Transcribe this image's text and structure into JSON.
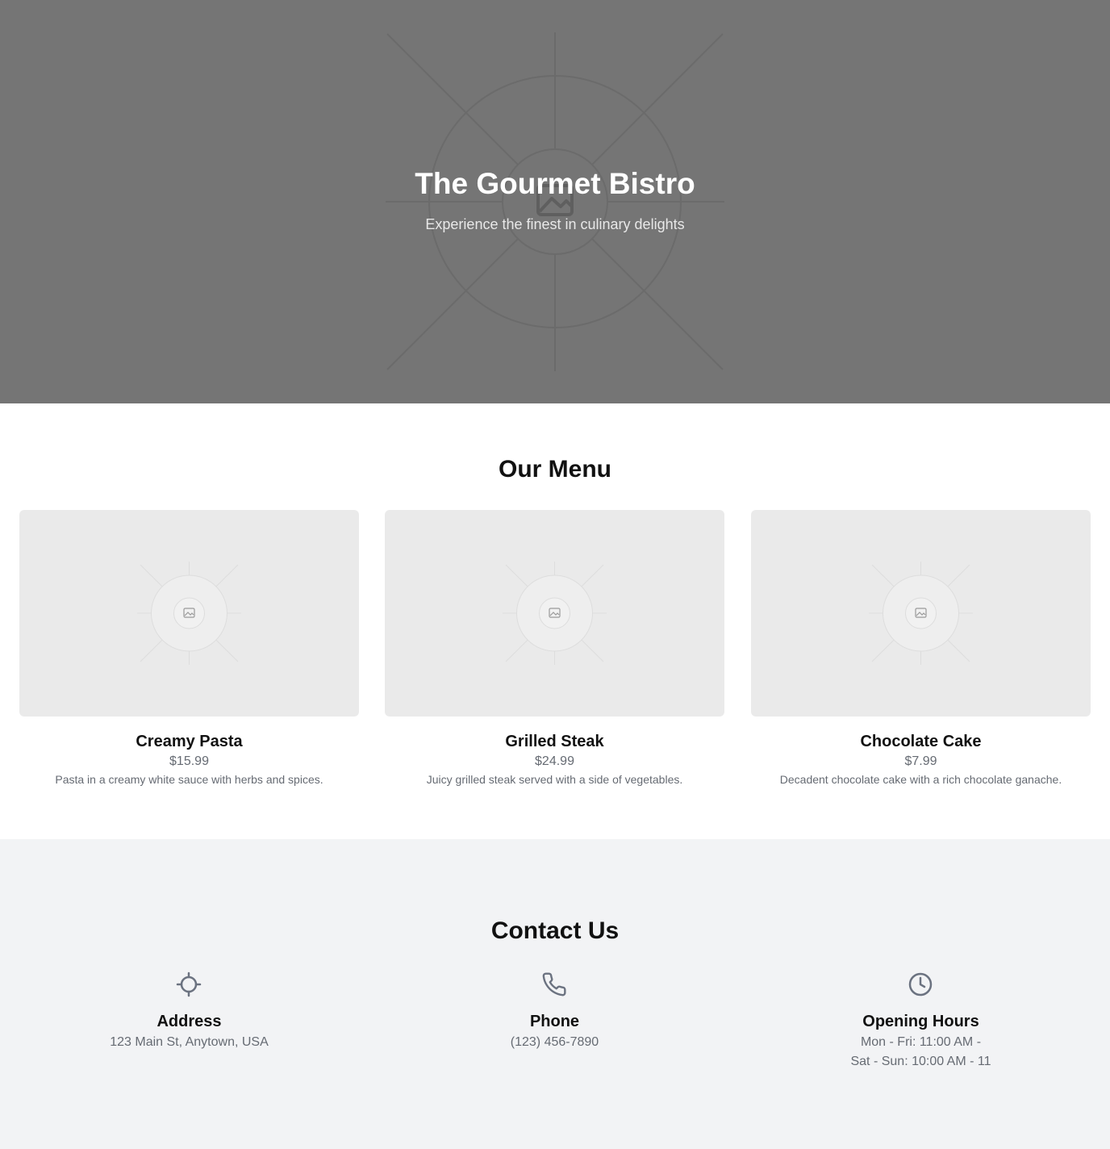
{
  "hero": {
    "title": "The Gourmet Bistro",
    "subtitle": "Experience the finest in culinary delights",
    "image_icon": "image-placeholder-icon",
    "background_color": "#757575"
  },
  "menu": {
    "heading": "Our Menu",
    "items": [
      {
        "name": "Creamy Pasta",
        "price": "$15.99",
        "description": "Pasta in a creamy white sauce with herbs and spices.",
        "image_icon": "image-placeholder-icon"
      },
      {
        "name": "Grilled Steak",
        "price": "$24.99",
        "description": "Juicy grilled steak served with a side of vegetables.",
        "image_icon": "image-placeholder-icon"
      },
      {
        "name": "Chocolate Cake",
        "price": "$7.99",
        "description": "Decadent chocolate cake with a rich chocolate ganache.",
        "image_icon": "image-placeholder-icon"
      }
    ]
  },
  "contact": {
    "heading": "Contact Us",
    "background_color": "#f2f3f5",
    "address": {
      "label": "Address",
      "value": "123 Main St, Anytown, USA",
      "icon": "location-crosshair-icon"
    },
    "phone": {
      "label": "Phone",
      "value": "(123) 456-7890",
      "icon": "phone-icon"
    },
    "hours": {
      "label": "Opening Hours",
      "weekday": "Mon - Fri: 11:00 AM -",
      "weekend": "Sat - Sun: 10:00 AM - 11",
      "icon": "clock-icon"
    }
  },
  "colors": {
    "text_primary": "#111111",
    "text_muted": "#666b73",
    "icon": "#6b7280"
  }
}
